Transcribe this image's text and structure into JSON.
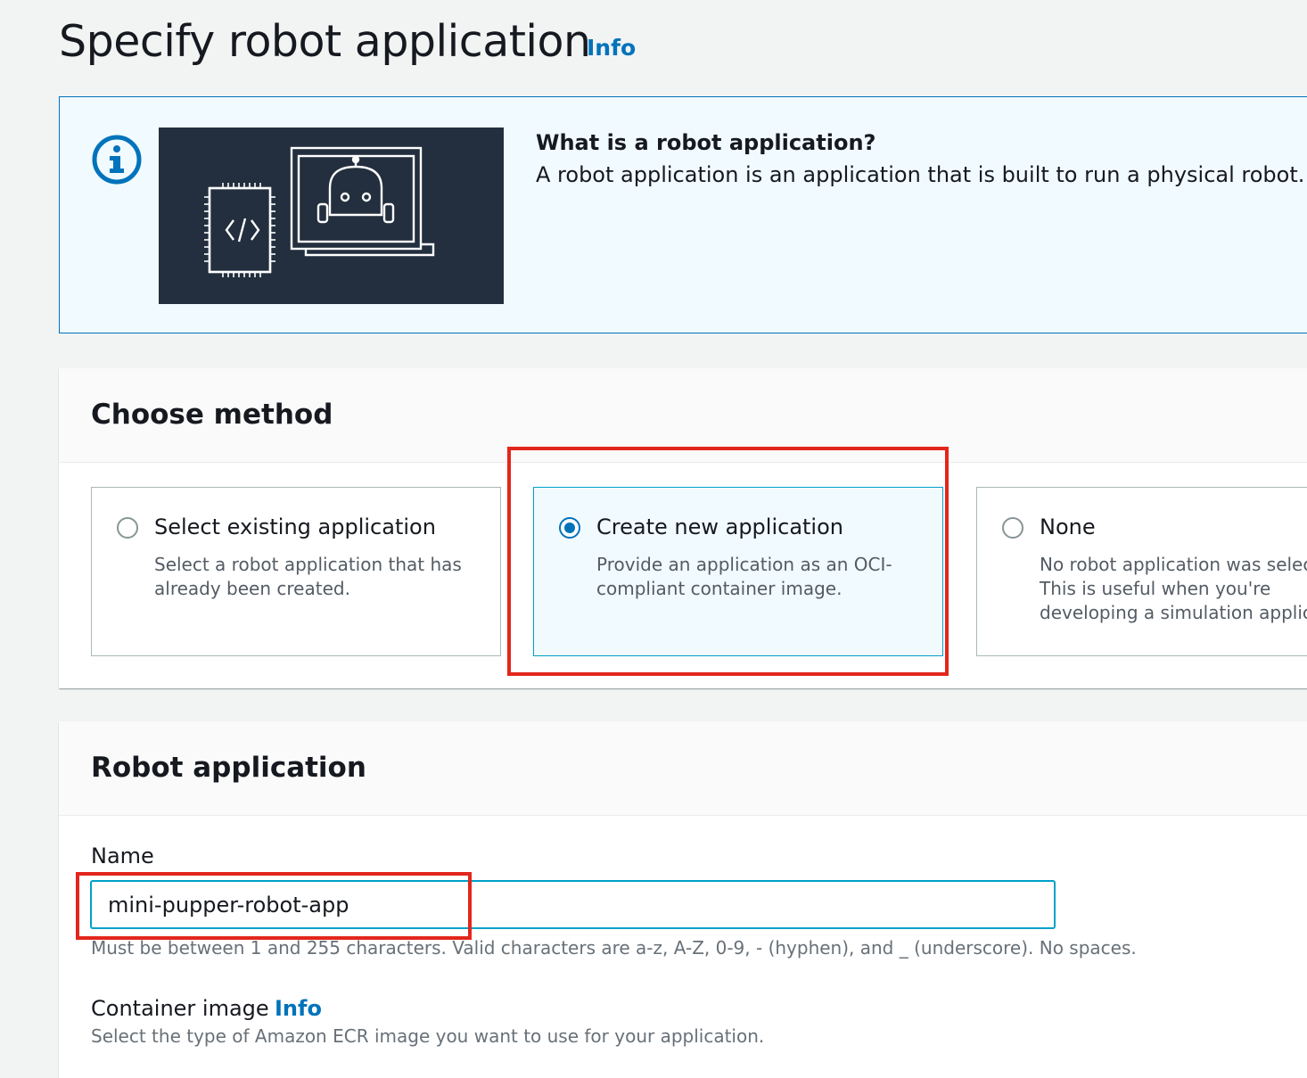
{
  "header": {
    "title": "Specify robot application",
    "info_link": "Info"
  },
  "info_banner": {
    "icon": "info-circle-icon",
    "illustration": "robot-application-illustration",
    "heading": "What is a robot application?",
    "text": "A robot application is an application that is built to run a physical robot."
  },
  "choose_method": {
    "title": "Choose method",
    "options": [
      {
        "label": "Select existing application",
        "description_lines": [
          "Select a robot application that has",
          "already been created."
        ],
        "selected": false
      },
      {
        "label": "Create new application",
        "description_lines": [
          "Provide an application as an OCI-",
          "compliant container image."
        ],
        "selected": true
      },
      {
        "label": "None",
        "description_lines": [
          "No robot application was selec",
          "This is useful when you're",
          "developing a simulation applic"
        ],
        "selected": false
      }
    ]
  },
  "robot_application": {
    "title": "Robot application",
    "name_label": "Name",
    "name_value": "mini-pupper-robot-app",
    "name_constraint": "Must be between 1 and 255 characters. Valid characters are a-z, A-Z, 0-9, - (hyphen), and _ (underscore). No spaces.",
    "container_image_label": "Container image",
    "container_image_info": "Info",
    "container_image_description": "Select the type of Amazon ECR image you want to use for your application."
  },
  "colors": {
    "accent": "#0073bb",
    "highlight": "#e3261c",
    "selected_tile_bg": "#f1faff",
    "illustration_bg": "#232f3e"
  }
}
